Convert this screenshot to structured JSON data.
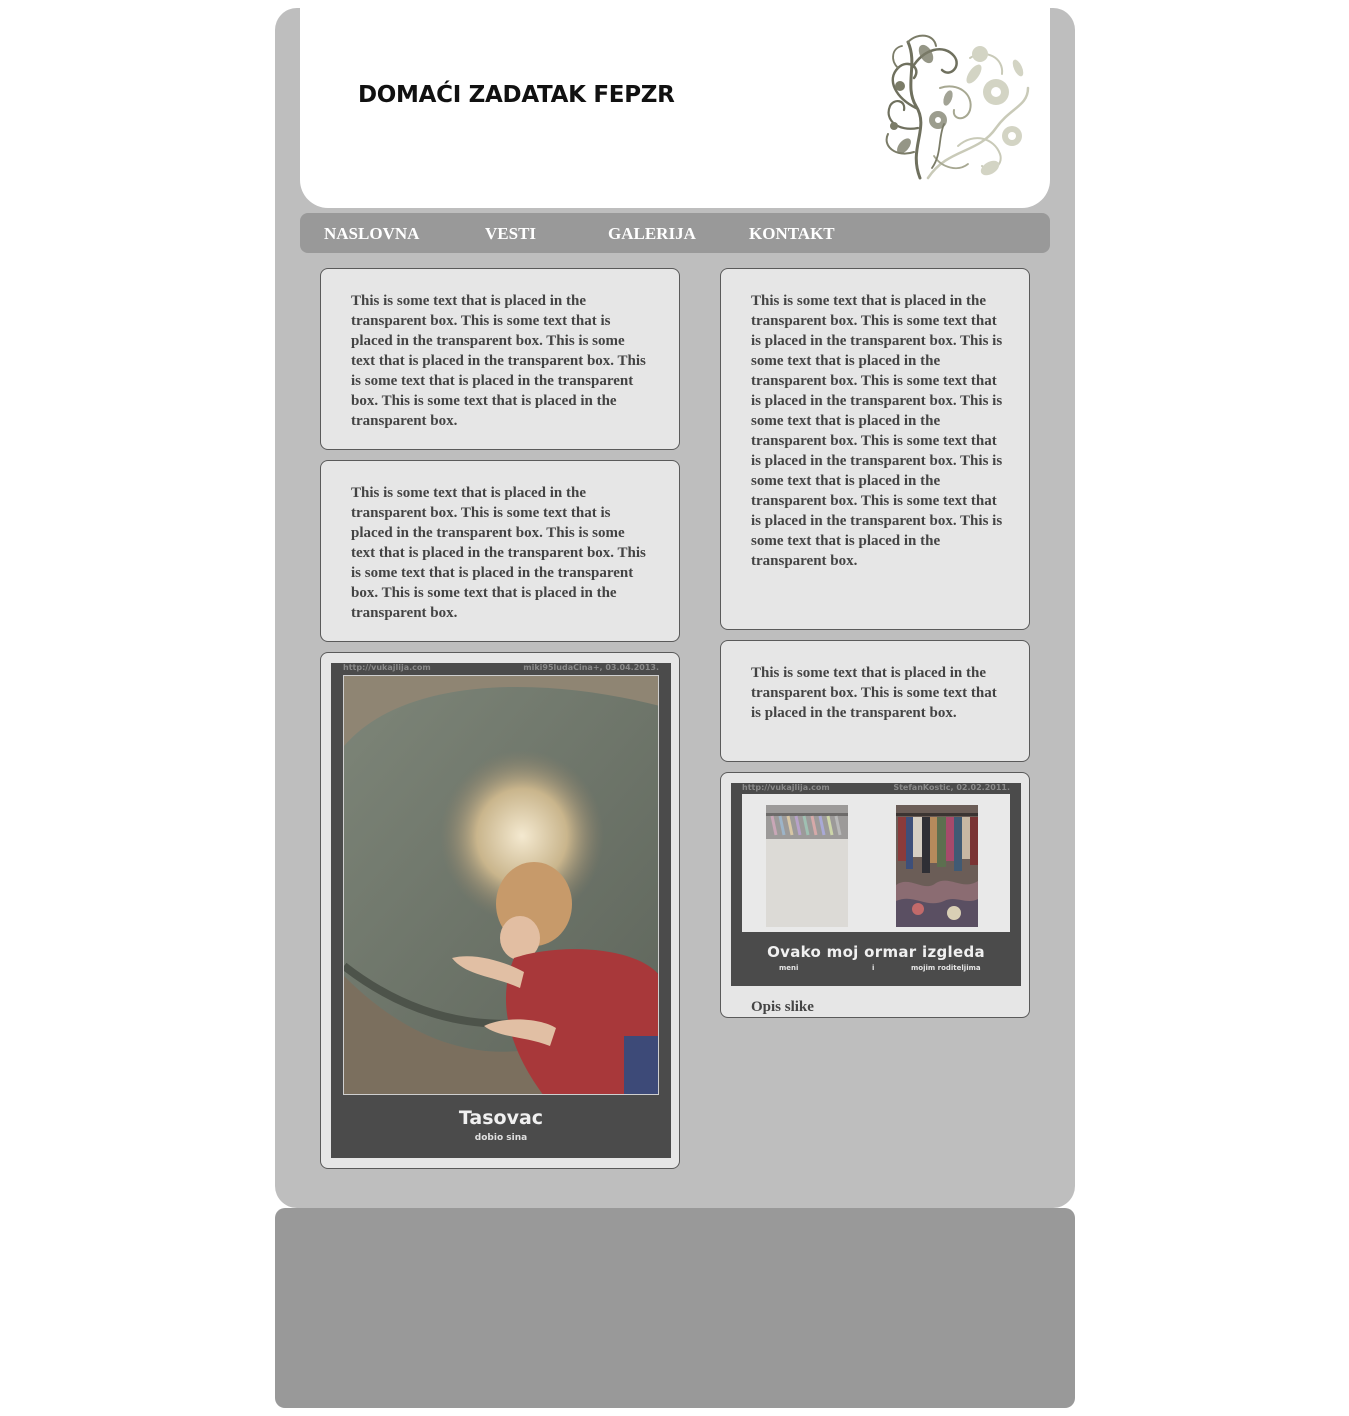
{
  "header": {
    "title": "DOMAĆI ZADATAK FEPZR"
  },
  "nav": {
    "items": [
      "NASLOVNA",
      "VESTI",
      "GALERIJA",
      "KONTAKT"
    ]
  },
  "boxes": {
    "b1": "This is some text that is placed in the transparent box. This is some text that is placed in the transparent box. This is some text that is placed in the transparent box. This is some text that is placed in the transparent box. This is some text that is placed in the transparent box.",
    "b2": "This is some text that is placed in the transparent box. This is some text that is placed in the transparent box. This is some text that is placed in the transparent box. This is some text that is placed in the transparent box. This is some text that is placed in the transparent box.",
    "b3": "This is some text that is placed in the transparent box. This is some text that is placed in the transparent box. This is some text that is placed in the transparent box. This is some text that is placed in the transparent box. This is some text that is placed in the transparent box. This is some text that is placed in the transparent box. This is some text that is placed in the transparent box. This is some text that is placed in the transparent box. This is some text that is placed in the transparent box.",
    "b4": "This is some text that is placed in the transparent box. This is some text that is placed in the transparent box."
  },
  "gallery": {
    "poster1": {
      "site": "http://vukajlija.com",
      "author_date": "miki95ludaCina+, 03.04.2013.",
      "caption": "Tasovac",
      "subcaption": "dobio sina"
    },
    "poster2": {
      "site": "http://vukajlija.com",
      "author_date": "StefanKostic, 02.02.2011.",
      "caption": "Ovako moj ormar izgleda",
      "sub_left": "meni",
      "sub_mid": "i",
      "sub_right": "mojim roditeljima"
    },
    "image_description": "Opis slike"
  },
  "colors": {
    "page_bg": "#bebebe",
    "nav_bg": "#999999",
    "box_bg": "#e6e6e6",
    "poster_bg": "#4b4b4b",
    "footer_bg": "#999999"
  }
}
